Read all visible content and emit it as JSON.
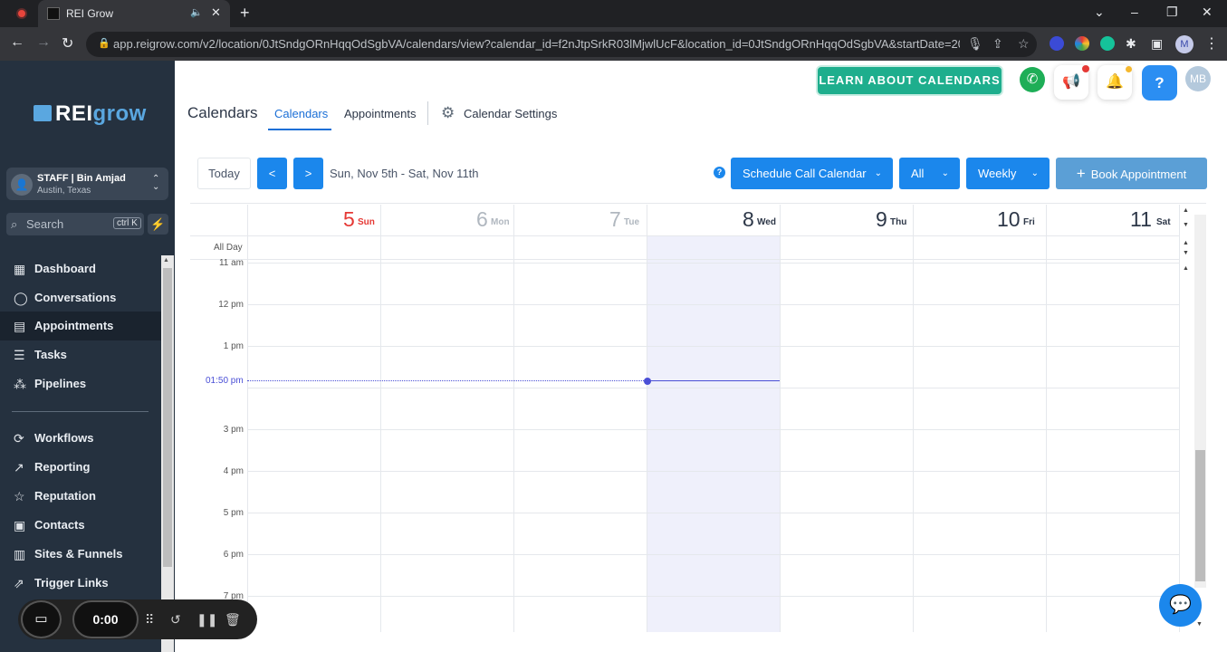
{
  "browser": {
    "tab_title": "REI Grow",
    "url": "app.reigrow.com/v2/location/0JtSndgORnHqqOdSgbVA/calendars/view?calendar_id=f2nJtpSrkR03lMjwlUcF&location_id=0JtSndgORnHqqOdSgbVA&startDate=2023-11...",
    "profile_initial": "M"
  },
  "sidebar": {
    "logo_rei": "REI",
    "logo_grow": "grow",
    "location_name": "STAFF | Bin Amjad",
    "location_city": "Austin, Texas",
    "search_placeholder": "Search",
    "search_shortcut": "ctrl K",
    "items": [
      {
        "label": "Dashboard",
        "icon": "dashboard-icon"
      },
      {
        "label": "Conversations",
        "icon": "chat-icon"
      },
      {
        "label": "Appointments",
        "icon": "calendar-icon"
      },
      {
        "label": "Tasks",
        "icon": "tasks-icon"
      },
      {
        "label": "Pipelines",
        "icon": "pipelines-icon"
      },
      {
        "label": "Workflows",
        "icon": "workflows-icon"
      },
      {
        "label": "Reporting",
        "icon": "reporting-icon"
      },
      {
        "label": "Reputation",
        "icon": "star-icon"
      },
      {
        "label": "Contacts",
        "icon": "contacts-icon"
      },
      {
        "label": "Sites & Funnels",
        "icon": "sites-icon"
      },
      {
        "label": "Trigger Links",
        "icon": "link-icon"
      }
    ]
  },
  "header": {
    "learn_button": "LEARN ABOUT CALENDARS",
    "help_label": "?",
    "avatar_initials": "MB"
  },
  "page": {
    "title": "Calendars",
    "tabs": [
      "Calendars",
      "Appointments",
      "Calendar Settings"
    ]
  },
  "controls": {
    "today": "Today",
    "prev": "<",
    "next": ">",
    "date_range": "Sun, Nov 5th - Sat, Nov 11th",
    "calendar_select": "Schedule Call Calendar",
    "filter_select": "All",
    "view_select": "Weekly",
    "book_button": "Book Appointment"
  },
  "calendar": {
    "days": [
      {
        "num": "5",
        "name": "Sun",
        "color": "#e53935"
      },
      {
        "num": "6",
        "name": "Mon",
        "color": "#b0b7bf"
      },
      {
        "num": "7",
        "name": "Tue",
        "color": "#b0b7bf"
      },
      {
        "num": "8",
        "name": "Wed",
        "color": "#2d3748"
      },
      {
        "num": "9",
        "name": "Thu",
        "color": "#2d3748"
      },
      {
        "num": "10",
        "name": "Fri",
        "color": "#2d3748"
      },
      {
        "num": "11",
        "name": "Sat",
        "color": "#2d3748"
      }
    ],
    "all_day_label": "All Day",
    "times": [
      "11 am",
      "12 pm",
      "1 pm",
      "3 pm",
      "4 pm",
      "5 pm",
      "6 pm",
      "7 pm"
    ],
    "current_time": "01:50 pm"
  },
  "recorder": {
    "timer": "0:00"
  },
  "colors": {
    "sidebar_bg": "#25313f",
    "accent_blue": "#1b87ec",
    "learn_green": "#1eae8d",
    "now_indicator": "#4a4fd6"
  }
}
